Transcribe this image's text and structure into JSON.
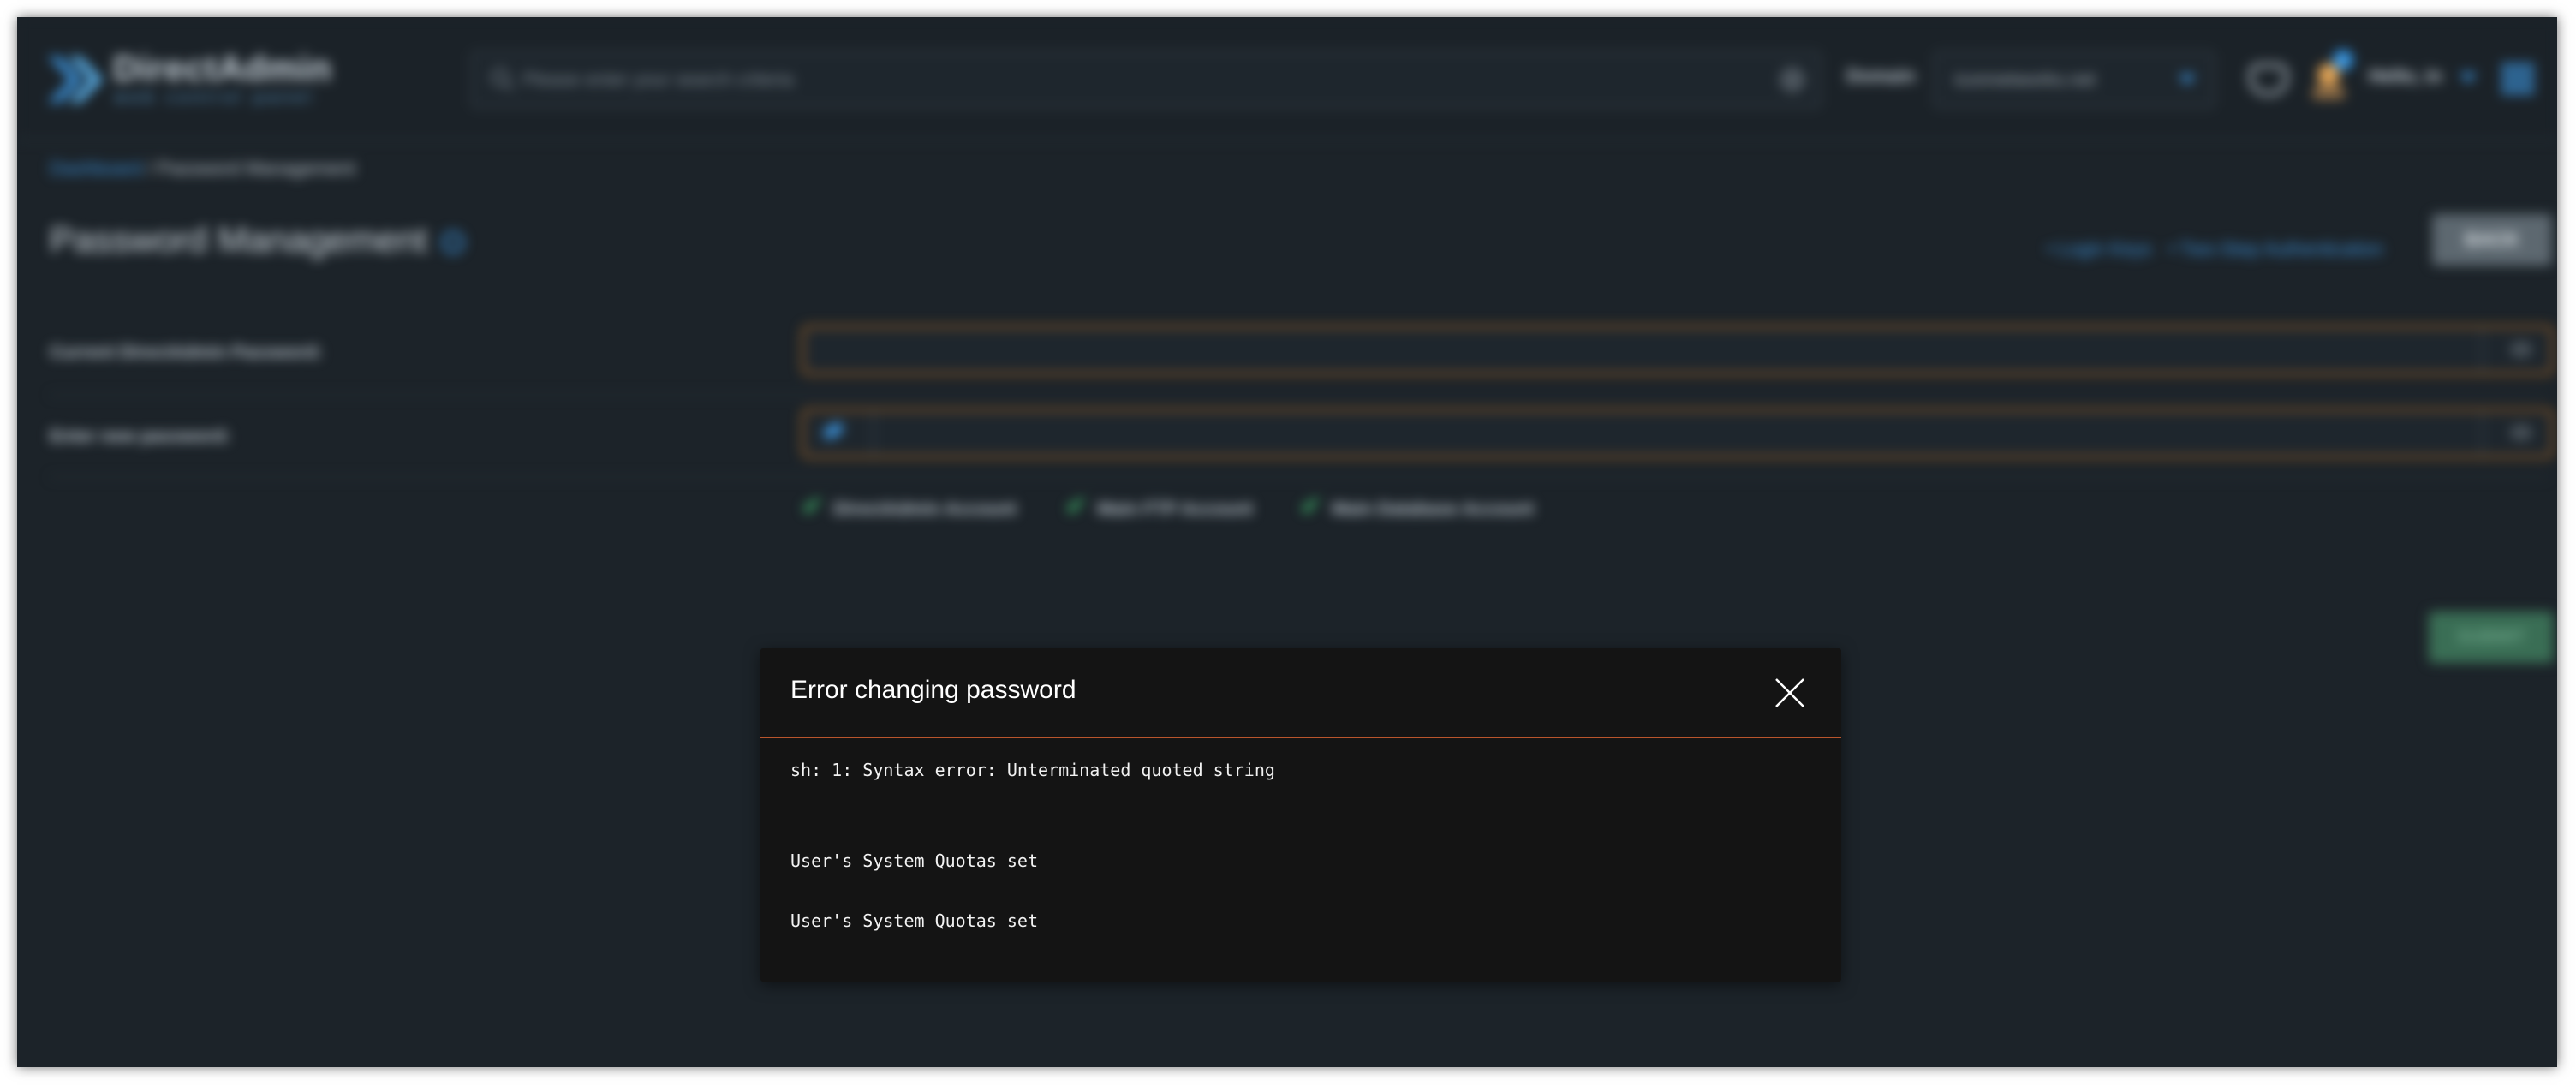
{
  "header": {
    "logo_title": "DirectAdmin",
    "logo_subtitle": "web control panel",
    "search_placeholder": "Please enter your search criteria",
    "domain_label": "Domain",
    "domain_value": "iconnetworks.net",
    "notification_count": "1",
    "greeting": "Hello, in"
  },
  "breadcrumb": {
    "link": "Dashboard",
    "separator": " / ",
    "current": "Password Management"
  },
  "page": {
    "title": "Password Management",
    "links": {
      "login_keys": "• Login Keys",
      "two_step": "• Two-Step Authentication"
    },
    "back_label": "BACK",
    "submit_label": "SUBMIT"
  },
  "form": {
    "current_password_label": "Current DirectAdmin Password:",
    "new_password_label": "Enter new password:",
    "checkboxes": [
      {
        "label": "DirectAdmin Account",
        "checked": true
      },
      {
        "label": "Main FTP Account",
        "checked": true
      },
      {
        "label": "Main Database Account",
        "checked": true
      }
    ]
  },
  "modal": {
    "title": "Error changing password",
    "lines": [
      "sh: 1: Syntax error: Unterminated quoted string",
      "User's System Quotas set",
      "User's System Quotas set"
    ]
  },
  "colors": {
    "background": "#1c2329",
    "accent": "#3a8fd6",
    "field_border": "#b06a24",
    "modal_bg": "#141414",
    "modal_divider": "#b9552c",
    "check": "#3fb36b"
  }
}
